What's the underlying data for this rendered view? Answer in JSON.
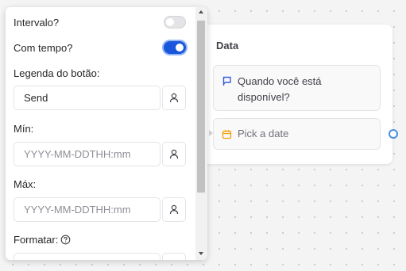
{
  "node": {
    "title": "Data",
    "question_text": "Quando você está disponível?",
    "question_icon": "message-flag-icon",
    "date_placeholder": "Pick a date",
    "date_icon": "calendar-icon"
  },
  "settings": {
    "interval_label": "Intervalo?",
    "interval_enabled": false,
    "with_time_label": "Com tempo?",
    "with_time_enabled": true,
    "button_label_label": "Legenda do botão:",
    "button_label_value": "Send",
    "min_label": "Mín:",
    "min_placeholder": "YYYY-MM-DDTHH:mm",
    "max_label": "Máx:",
    "max_placeholder": "YYYY-MM-DDTHH:mm",
    "format_label": "Formatar:",
    "variable_icon": "user-variable-icon",
    "help_icon": "help-circle-icon"
  },
  "colors": {
    "toggle_on": "#1a56db",
    "handle": "#4a90e2",
    "date_icon": "#f59e0b",
    "question_icon": "#3b5bdb"
  }
}
